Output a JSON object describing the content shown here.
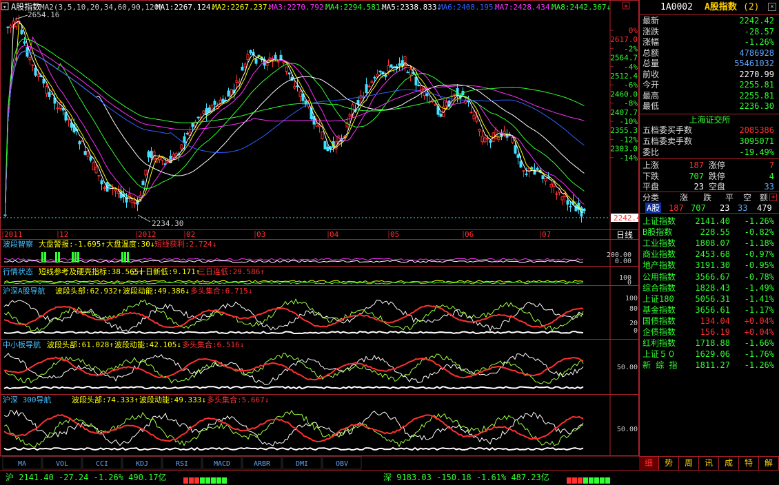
{
  "title": "A股指数",
  "code": "1A0002",
  "ma_header": "MA2(3,5,10,20,34,60,90,120)",
  "ma_labels": [
    {
      "t": "MA1:2267.124↓",
      "c": "#ffffff"
    },
    {
      "t": "MA2:2267.237↓",
      "c": "#ffff00"
    },
    {
      "t": "MA3:2270.792↓",
      "c": "#ff30ff"
    },
    {
      "t": "MA4:2294.581↓",
      "c": "#30ff30"
    },
    {
      "t": "MA5:2338.833↓",
      "c": "#ffffff"
    },
    {
      "t": "MA6:2408.195↓",
      "c": "#3060ff"
    },
    {
      "t": "MA7:2428.434↓",
      "c": "#ff30ff"
    },
    {
      "t": "MA8:2442.367↓",
      "c": "#30ff30"
    }
  ],
  "price_axis": [
    {
      "t": "0%",
      "c": "#ff3030"
    },
    {
      "t": "2617.0",
      "c": "#ff3030"
    },
    {
      "t": "-2%",
      "c": "#30ff30"
    },
    {
      "t": "2564.7",
      "c": "#30ff30"
    },
    {
      "t": "-4%",
      "c": "#30ff30"
    },
    {
      "t": "2512.4",
      "c": "#30ff30"
    },
    {
      "t": "-6%",
      "c": "#30ff30"
    },
    {
      "t": "2460.0",
      "c": "#30ff30"
    },
    {
      "t": "-8%",
      "c": "#30ff30"
    },
    {
      "t": "2407.7",
      "c": "#30ff30"
    },
    {
      "t": "-10%",
      "c": "#30ff30"
    },
    {
      "t": "2355.3",
      "c": "#30ff30"
    },
    {
      "t": "-12%",
      "c": "#30ff30"
    },
    {
      "t": "2303.0",
      "c": "#30ff30"
    },
    {
      "t": "-14%",
      "c": "#30ff30"
    }
  ],
  "hi_label": "2654.16",
  "lo_label": "2234.30",
  "last_price": "2242.4",
  "months": [
    "2011",
    "12",
    "2012",
    "02",
    "03",
    "04",
    "05",
    "06",
    "07"
  ],
  "period": "日线",
  "p1": {
    "name": "波段智察",
    "a": "大盘警报:-1.695↑",
    "b": "大盘温度:30↓",
    "c": "短线获利:2.724↓",
    "axis": [
      "200.00",
      "0.00"
    ]
  },
  "p2": {
    "name": "行情状态",
    "a": "短线参考及硬壳指标:38.565↓",
    "b": "三十日新低:9.171↑",
    "c": "三日连低:29.586↑",
    "axis": [
      "100",
      "0"
    ]
  },
  "p3": {
    "name": "沪深A股导航",
    "a": "波段头部:62.932↑",
    "b": "波段动能:49.386↓",
    "c": "多头集合:6.715↓",
    "axis": [
      "100",
      "80",
      "20",
      "0"
    ]
  },
  "p4": {
    "name": "中小板导航",
    "a": "波段头部:61.028↑",
    "b": "波段动能:42.105↓",
    "c": "多头集合:6.516↓",
    "axis": [
      "50.00"
    ]
  },
  "p5": {
    "name": "沪深 300导航",
    "a": "波段头部:74.333↑",
    "b": "波段动能:49.333↓",
    "c": "多头集合:5.667↓",
    "axis": [
      "50.00"
    ]
  },
  "ind_tabs": [
    "MA",
    "VOL",
    "CCI",
    "KDJ",
    "RSI",
    "MACD",
    "ARBR",
    "DMI",
    "OBV"
  ],
  "quote": [
    {
      "l": "最新",
      "v": "2242.42",
      "c": "#30ff30"
    },
    {
      "l": "涨跌",
      "v": "-28.57",
      "c": "#30ff30"
    },
    {
      "l": "涨幅",
      "v": "-1.26%",
      "c": "#30ff30"
    },
    {
      "l": "总额",
      "v": "4786928",
      "c": "#5fa8ff"
    },
    {
      "l": "总量",
      "v": "55461032",
      "c": "#5fa8ff"
    },
    {
      "l": "前收",
      "v": "2270.99",
      "c": "#ffffff"
    },
    {
      "l": "今开",
      "v": "2255.81",
      "c": "#30ff30"
    },
    {
      "l": "最高",
      "v": "2255.81",
      "c": "#30ff30"
    },
    {
      "l": "最低",
      "v": "2236.30",
      "c": "#30ff30"
    }
  ],
  "exchange": "上海证交所",
  "depth": [
    {
      "l": "五档委买手数",
      "v": "2085386",
      "c": "#ff3030"
    },
    {
      "l": "五档委卖手数",
      "v": "3095071",
      "c": "#30ff30"
    },
    {
      "l": "委比",
      "v": "-19.49%",
      "c": "#30ff30"
    }
  ],
  "breadth": [
    {
      "l1": "上涨",
      "v1": "187",
      "c1": "#ff3030",
      "l2": "涨停",
      "v2": "7",
      "c2": "#ff3030"
    },
    {
      "l1": "下跌",
      "v1": "707",
      "c1": "#30ff30",
      "l2": "跌停",
      "v2": "4",
      "c2": "#30ff30"
    },
    {
      "l1": "平盘",
      "v1": "23",
      "c1": "#ffffff",
      "l2": "空盘",
      "v2": "33",
      "c2": "#5fa8ff"
    }
  ],
  "cls_head": [
    "分类",
    "涨",
    "跌",
    "平",
    "空",
    "额"
  ],
  "cls_row": {
    "name": "A股",
    "up": "187",
    "dn": "707",
    "flat": "23",
    "halt": "33",
    "amt": "479"
  },
  "indices": [
    {
      "n": "上证指数",
      "v": "2141.40",
      "p": "-1.26%",
      "c": "#30ff30"
    },
    {
      "n": "B股指数",
      "v": "228.55",
      "p": "-0.82%",
      "c": "#30ff30"
    },
    {
      "n": "工业指数",
      "v": "1808.07",
      "p": "-1.18%",
      "c": "#30ff30"
    },
    {
      "n": "商业指数",
      "v": "2453.68",
      "p": "-0.97%",
      "c": "#30ff30"
    },
    {
      "n": "地产指数",
      "v": "3191.30",
      "p": "-0.95%",
      "c": "#30ff30"
    },
    {
      "n": "公用指数",
      "v": "3566.67",
      "p": "-0.78%",
      "c": "#30ff30"
    },
    {
      "n": "综合指数",
      "v": "1828.43",
      "p": "-1.49%",
      "c": "#30ff30"
    },
    {
      "n": "上证180",
      "v": "5056.31",
      "p": "-1.41%",
      "c": "#30ff30"
    },
    {
      "n": "基金指数",
      "v": "3656.61",
      "p": "-1.17%",
      "c": "#30ff30"
    },
    {
      "n": "国债指数",
      "v": "134.04",
      "p": "+0.04%",
      "c": "#ff3030"
    },
    {
      "n": "企债指数",
      "v": "156.19",
      "p": "+0.04%",
      "c": "#ff3030"
    },
    {
      "n": "红利指数",
      "v": "1718.88",
      "p": "-1.66%",
      "c": "#30ff30"
    },
    {
      "n": "上证５０",
      "v": "1629.06",
      "p": "-1.76%",
      "c": "#30ff30"
    },
    {
      "n": "新 综 指",
      "v": "1811.27",
      "p": "-1.26%",
      "c": "#30ff30"
    }
  ],
  "side_tabs": [
    "细",
    "势",
    "周",
    "讯",
    "成",
    "特",
    "解"
  ],
  "status": {
    "sh": "沪 2141.40 -27.24 -1.26% 490.17亿",
    "sz": "深 9183.03 -150.18 -1.61% 487.23亿"
  },
  "colors": {
    "up": "#ff3030",
    "down": "#30ff30",
    "cyan": "#40e0ff",
    "frame": "#b0202b",
    "blue": "#3060ff",
    "magenta": "#ff30ff",
    "yellow": "#ffff00"
  }
}
